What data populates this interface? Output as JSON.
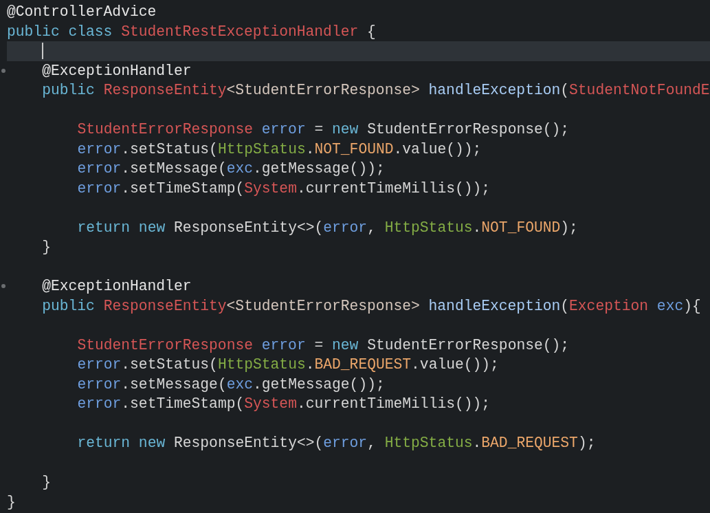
{
  "editor": {
    "lines": [
      {
        "current": false,
        "fold": false,
        "tokens": [
          {
            "text": "@ControllerAdvice",
            "kind": "annotation"
          }
        ]
      },
      {
        "current": false,
        "fold": false,
        "tokens": [
          {
            "text": "public class ",
            "kind": "keyword"
          },
          {
            "text": "StudentRestExceptionHandler",
            "kind": "type"
          },
          {
            "text": " {",
            "kind": "plain"
          }
        ],
        "children": [
          {
            "current": true,
            "fold": false
          },
          {
            "current": false,
            "fold": true,
            "tokens": [
              {
                "text": "@ExceptionHandler",
                "kind": "annotation"
              }
            ]
          },
          {
            "current": false,
            "fold": false,
            "tokens": [
              {
                "text": "public ",
                "kind": "keyword"
              },
              {
                "text": "ResponseEntity",
                "kind": "type"
              },
              {
                "text": "<StudentErrorResponse> ",
                "kind": "generic"
              },
              {
                "text": "handleException",
                "kind": "method"
              },
              {
                "text": "(",
                "kind": "plain"
              },
              {
                "text": "StudentNotFoundE",
                "kind": "type"
              }
            ],
            "children": [
              {
                "current": false,
                "fold": false
              },
              {
                "current": false,
                "fold": false,
                "tokens": [
                  {
                    "text": "StudentErrorResponse ",
                    "kind": "type"
                  },
                  {
                    "text": "error",
                    "kind": "variable"
                  },
                  {
                    "text": " = ",
                    "kind": "plain"
                  },
                  {
                    "text": "new",
                    "kind": "keyword"
                  },
                  {
                    "text": " StudentErrorResponse();",
                    "kind": "plain"
                  }
                ]
              },
              {
                "current": false,
                "fold": false,
                "tokens": [
                  {
                    "text": "error",
                    "kind": "variable"
                  },
                  {
                    "text": ".setStatus(",
                    "kind": "plain"
                  },
                  {
                    "text": "HttpStatus",
                    "kind": "static"
                  },
                  {
                    "text": ".",
                    "kind": "plain"
                  },
                  {
                    "text": "NOT_FOUND",
                    "kind": "constant"
                  },
                  {
                    "text": ".value());",
                    "kind": "plain"
                  }
                ]
              },
              {
                "current": false,
                "fold": false,
                "tokens": [
                  {
                    "text": "error",
                    "kind": "variable"
                  },
                  {
                    "text": ".setMessage(",
                    "kind": "plain"
                  },
                  {
                    "text": "exc",
                    "kind": "variable"
                  },
                  {
                    "text": ".getMessage());",
                    "kind": "plain"
                  }
                ]
              },
              {
                "current": false,
                "fold": false,
                "tokens": [
                  {
                    "text": "error",
                    "kind": "variable"
                  },
                  {
                    "text": ".setTimeStamp(",
                    "kind": "plain"
                  },
                  {
                    "text": "System",
                    "kind": "type"
                  },
                  {
                    "text": ".currentTimeMillis());",
                    "kind": "plain"
                  }
                ]
              },
              {
                "current": false,
                "fold": false
              },
              {
                "current": false,
                "fold": false,
                "tokens": [
                  {
                    "text": "return new",
                    "kind": "keyword"
                  },
                  {
                    "text": " ResponseEntity<>(",
                    "kind": "plain"
                  },
                  {
                    "text": "error",
                    "kind": "variable"
                  },
                  {
                    "text": ", ",
                    "kind": "plain"
                  },
                  {
                    "text": "HttpStatus",
                    "kind": "static"
                  },
                  {
                    "text": ".",
                    "kind": "plain"
                  },
                  {
                    "text": "NOT_FOUND",
                    "kind": "constant"
                  },
                  {
                    "text": ");",
                    "kind": "plain"
                  }
                ]
              }
            ]
          },
          {
            "current": false,
            "fold": false,
            "tokens": [
              {
                "text": "}",
                "kind": "plain"
              }
            ]
          },
          {
            "current": false,
            "fold": false
          },
          {
            "current": false,
            "fold": true,
            "tokens": [
              {
                "text": "@ExceptionHandler",
                "kind": "annotation"
              }
            ]
          },
          {
            "current": false,
            "fold": false,
            "tokens": [
              {
                "text": "public ",
                "kind": "keyword"
              },
              {
                "text": "ResponseEntity",
                "kind": "type"
              },
              {
                "text": "<StudentErrorResponse> ",
                "kind": "generic"
              },
              {
                "text": "handleException",
                "kind": "method"
              },
              {
                "text": "(",
                "kind": "plain"
              },
              {
                "text": "Exception ",
                "kind": "type"
              },
              {
                "text": "exc",
                "kind": "variable"
              },
              {
                "text": "){",
                "kind": "plain"
              }
            ],
            "children": [
              {
                "current": false,
                "fold": false
              },
              {
                "current": false,
                "fold": false,
                "tokens": [
                  {
                    "text": "StudentErrorResponse ",
                    "kind": "type"
                  },
                  {
                    "text": "error",
                    "kind": "variable"
                  },
                  {
                    "text": " = ",
                    "kind": "plain"
                  },
                  {
                    "text": "new",
                    "kind": "keyword"
                  },
                  {
                    "text": " StudentErrorResponse();",
                    "kind": "plain"
                  }
                ]
              },
              {
                "current": false,
                "fold": false,
                "tokens": [
                  {
                    "text": "error",
                    "kind": "variable"
                  },
                  {
                    "text": ".setStatus(",
                    "kind": "plain"
                  },
                  {
                    "text": "HttpStatus",
                    "kind": "static"
                  },
                  {
                    "text": ".",
                    "kind": "plain"
                  },
                  {
                    "text": "BAD_REQUEST",
                    "kind": "constant"
                  },
                  {
                    "text": ".value());",
                    "kind": "plain"
                  }
                ]
              },
              {
                "current": false,
                "fold": false,
                "tokens": [
                  {
                    "text": "error",
                    "kind": "variable"
                  },
                  {
                    "text": ".setMessage(",
                    "kind": "plain"
                  },
                  {
                    "text": "exc",
                    "kind": "variable"
                  },
                  {
                    "text": ".getMessage());",
                    "kind": "plain"
                  }
                ]
              },
              {
                "current": false,
                "fold": false,
                "tokens": [
                  {
                    "text": "error",
                    "kind": "variable"
                  },
                  {
                    "text": ".setTimeStamp(",
                    "kind": "plain"
                  },
                  {
                    "text": "System",
                    "kind": "type"
                  },
                  {
                    "text": ".currentTimeMillis());",
                    "kind": "plain"
                  }
                ]
              },
              {
                "current": false,
                "fold": false
              },
              {
                "current": false,
                "fold": false,
                "tokens": [
                  {
                    "text": "return new",
                    "kind": "keyword"
                  },
                  {
                    "text": " ResponseEntity<>(",
                    "kind": "plain"
                  },
                  {
                    "text": "error",
                    "kind": "variable"
                  },
                  {
                    "text": ", ",
                    "kind": "plain"
                  },
                  {
                    "text": "HttpStatus",
                    "kind": "static"
                  },
                  {
                    "text": ".",
                    "kind": "plain"
                  },
                  {
                    "text": "BAD_REQUEST",
                    "kind": "constant"
                  },
                  {
                    "text": ");",
                    "kind": "plain"
                  }
                ]
              },
              {
                "current": false,
                "fold": false
              }
            ]
          },
          {
            "current": false,
            "fold": false,
            "tokens": [
              {
                "text": "}",
                "kind": "plain"
              }
            ]
          }
        ]
      },
      {
        "current": false,
        "fold": false,
        "tokens": [
          {
            "text": "}",
            "kind": "plain"
          }
        ]
      }
    ]
  }
}
